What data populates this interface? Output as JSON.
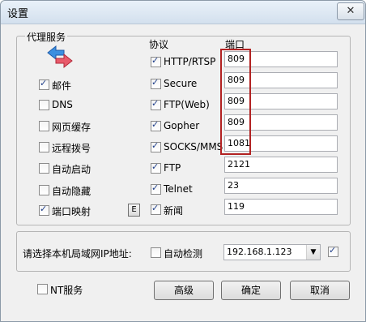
{
  "window": {
    "title": "设置",
    "close_glyph": "✕"
  },
  "proxy_group": {
    "title": "代理服务"
  },
  "headers": {
    "protocol": "协议",
    "port": "端口"
  },
  "left_options": [
    {
      "label": "邮件",
      "checked": true
    },
    {
      "label": "DNS",
      "checked": false
    },
    {
      "label": "网页缓存",
      "checked": false
    },
    {
      "label": "远程拨号",
      "checked": false
    },
    {
      "label": "自动启动",
      "checked": false
    },
    {
      "label": "自动隐藏",
      "checked": false
    },
    {
      "label": "端口映射",
      "checked": true
    }
  ],
  "e_button": "E",
  "protocols": [
    {
      "label": "HTTP/RTSP",
      "checked": true,
      "port": "809"
    },
    {
      "label": "Secure",
      "checked": true,
      "port": "809"
    },
    {
      "label": "FTP(Web)",
      "checked": true,
      "port": "809"
    },
    {
      "label": "Gopher",
      "checked": true,
      "port": "809"
    },
    {
      "label": "SOCKS/MMS",
      "checked": true,
      "port": "1081"
    },
    {
      "label": "FTP",
      "checked": true,
      "port": "2121"
    },
    {
      "label": "Telnet",
      "checked": true,
      "port": "23"
    },
    {
      "label": "新闻",
      "checked": true,
      "port": "119"
    }
  ],
  "ip_section": {
    "label": "请选择本机局域网IP地址:",
    "auto_detect_label": "自动检测",
    "auto_detect_checked": false,
    "selected_ip": "192.168.1.123",
    "enabled_checked": true
  },
  "nt_service": {
    "label": "NT服务",
    "checked": false
  },
  "buttons": {
    "advanced": "高级",
    "ok": "确定",
    "cancel": "取消"
  },
  "icons": {
    "proxy": "arrows-exchange-icon"
  },
  "colors": {
    "highlight_box": "#b22222",
    "check": "#1f3f8a"
  }
}
